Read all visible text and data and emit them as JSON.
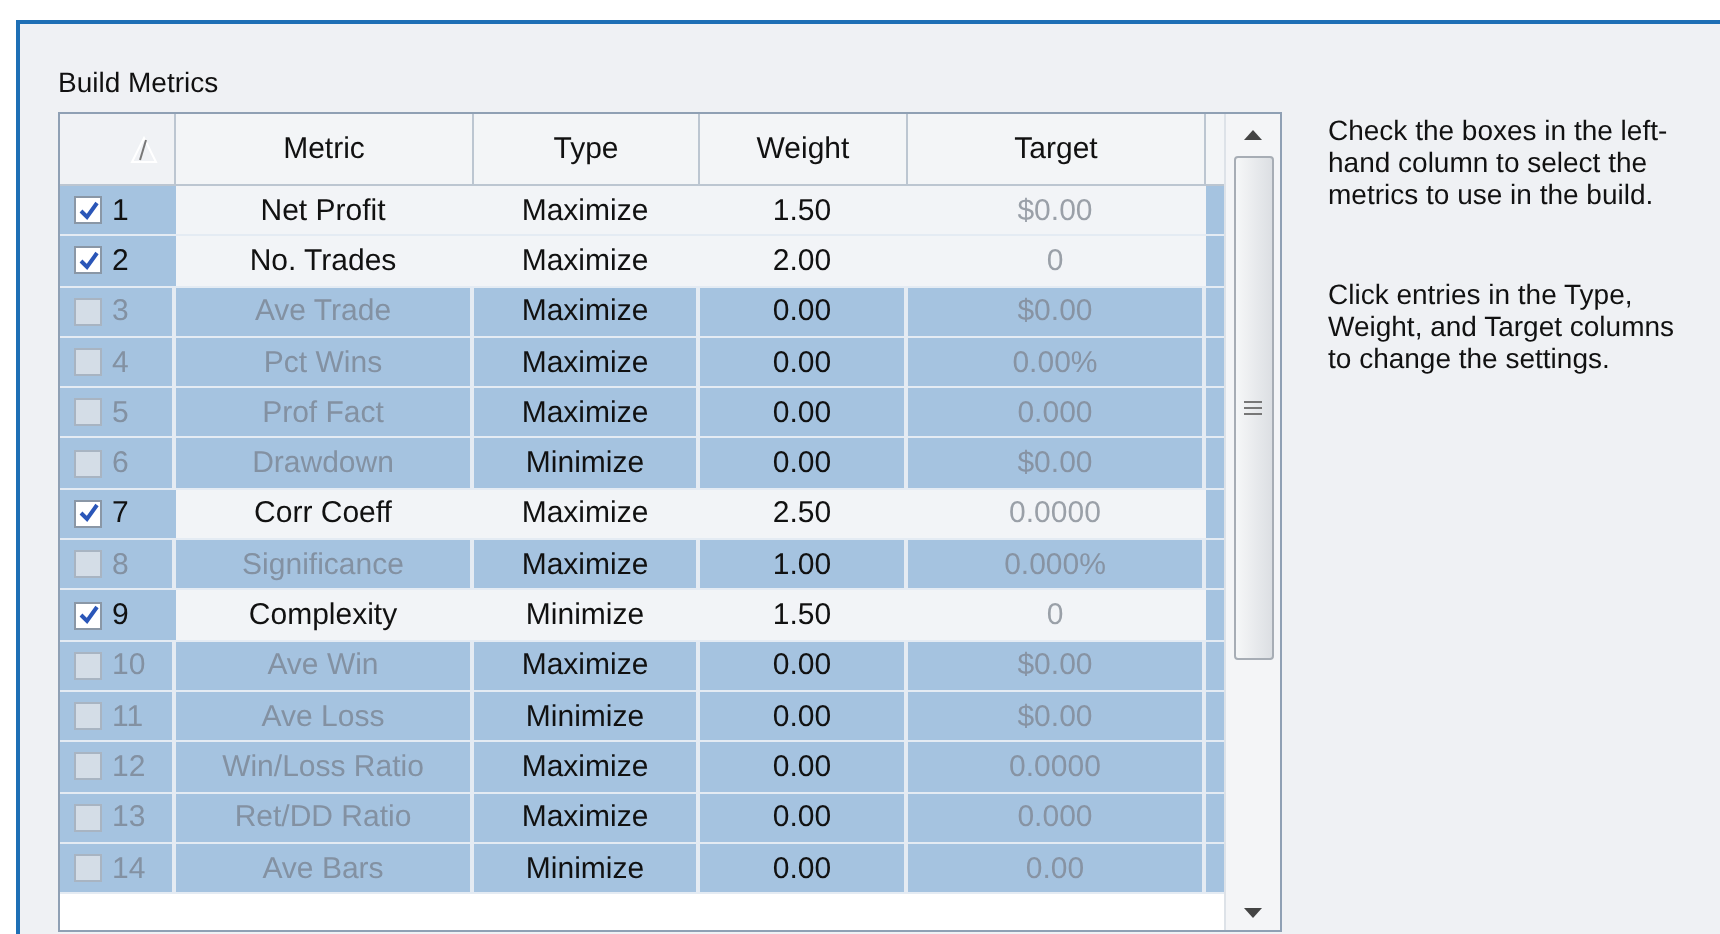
{
  "group": {
    "title": "Build Metrics"
  },
  "table": {
    "columns": [
      "Metric",
      "Type",
      "Weight",
      "Target"
    ],
    "rows": [
      {
        "number": "1",
        "metric": "Net Profit",
        "type": "Maximize",
        "weight": "1.50",
        "target": "$0.00",
        "checked": true
      },
      {
        "number": "2",
        "metric": "No. Trades",
        "type": "Maximize",
        "weight": "2.00",
        "target": "0",
        "checked": true
      },
      {
        "number": "3",
        "metric": "Ave Trade",
        "type": "Maximize",
        "weight": "0.00",
        "target": "$0.00",
        "checked": false
      },
      {
        "number": "4",
        "metric": "Pct Wins",
        "type": "Maximize",
        "weight": "0.00",
        "target": "0.00%",
        "checked": false
      },
      {
        "number": "5",
        "metric": "Prof Fact",
        "type": "Maximize",
        "weight": "0.00",
        "target": "0.000",
        "checked": false
      },
      {
        "number": "6",
        "metric": "Drawdown",
        "type": "Minimize",
        "weight": "0.00",
        "target": "$0.00",
        "checked": false
      },
      {
        "number": "7",
        "metric": "Corr Coeff",
        "type": "Maximize",
        "weight": "2.50",
        "target": "0.0000",
        "checked": true
      },
      {
        "number": "8",
        "metric": "Significance",
        "type": "Maximize",
        "weight": "1.00",
        "target": "0.000%",
        "checked": false
      },
      {
        "number": "9",
        "metric": "Complexity",
        "type": "Minimize",
        "weight": "1.50",
        "target": "0",
        "checked": true
      },
      {
        "number": "10",
        "metric": "Ave Win",
        "type": "Maximize",
        "weight": "0.00",
        "target": "$0.00",
        "checked": false
      },
      {
        "number": "11",
        "metric": "Ave Loss",
        "type": "Minimize",
        "weight": "0.00",
        "target": "$0.00",
        "checked": false
      },
      {
        "number": "12",
        "metric": "Win/Loss Ratio",
        "type": "Maximize",
        "weight": "0.00",
        "target": "0.0000",
        "checked": false
      },
      {
        "number": "13",
        "metric": "Ret/DD Ratio",
        "type": "Maximize",
        "weight": "0.00",
        "target": "0.000",
        "checked": false
      },
      {
        "number": "14",
        "metric": "Ave Bars",
        "type": "Minimize",
        "weight": "0.00",
        "target": "0.00",
        "checked": false
      }
    ]
  },
  "help": [
    "Check the boxes in the left-hand column to select the metrics to use in the build.",
    "Click entries in the Type, Weight, and Target columns to change the settings."
  ]
}
